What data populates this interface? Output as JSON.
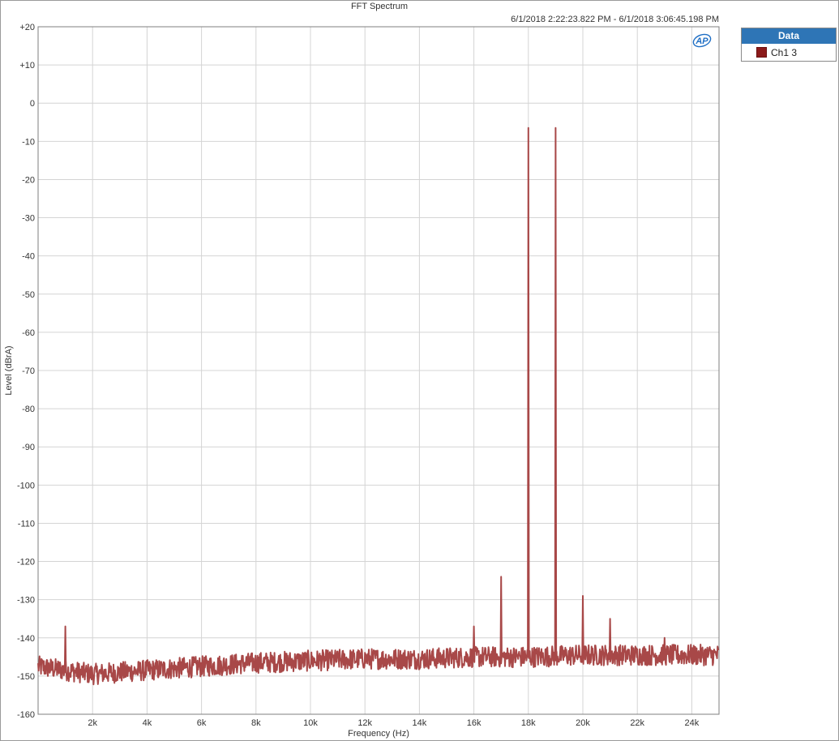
{
  "chart_data": {
    "type": "line",
    "title": "FFT Spectrum",
    "subtitle": "6/1/2018 2:22:23.822 PM - 6/1/2018 3:06:45.198 PM",
    "xlabel": "Frequency (Hz)",
    "ylabel": "Level (dBrA)",
    "xlim": [
      0,
      25000
    ],
    "ylim": [
      -160,
      20
    ],
    "x_ticks": [
      2000,
      4000,
      6000,
      8000,
      10000,
      12000,
      14000,
      16000,
      18000,
      20000,
      22000,
      24000
    ],
    "x_tick_labels": [
      "2k",
      "4k",
      "6k",
      "8k",
      "10k",
      "12k",
      "14k",
      "16k",
      "18k",
      "20k",
      "22k",
      "24k"
    ],
    "y_ticks": [
      20,
      10,
      0,
      -10,
      -20,
      -30,
      -40,
      -50,
      -60,
      -70,
      -80,
      -90,
      -100,
      -110,
      -120,
      -130,
      -140,
      -150,
      -160
    ],
    "y_tick_labels": [
      "+20",
      "+10",
      "0",
      "-10",
      "-20",
      "-30",
      "-40",
      "-50",
      "-60",
      "-70",
      "-80",
      "-90",
      "-100",
      "-110",
      "-120",
      "-130",
      "-140",
      "-150",
      "-160"
    ],
    "grid": true,
    "legend_position": "outside-top-right",
    "legend_title": "Data",
    "series": [
      {
        "name": "Ch1 3",
        "color": "#a84848",
        "noise_floor": [
          [
            0,
            -147.5
          ],
          [
            2000,
            -149.5
          ],
          [
            4000,
            -148.5
          ],
          [
            6000,
            -147.5
          ],
          [
            8000,
            -146.5
          ],
          [
            10000,
            -146
          ],
          [
            12000,
            -145.5
          ],
          [
            14000,
            -145.5
          ],
          [
            16000,
            -145
          ],
          [
            18000,
            -145
          ],
          [
            20000,
            -144.5
          ],
          [
            22000,
            -144.5
          ],
          [
            24000,
            -144.5
          ],
          [
            25000,
            -144.5
          ]
        ],
        "peaks": [
          {
            "x": 1000,
            "y": -137
          },
          {
            "x": 16000,
            "y": -137
          },
          {
            "x": 17000,
            "y": -124
          },
          {
            "x": 18000,
            "y": -6.5
          },
          {
            "x": 19000,
            "y": -6.5
          },
          {
            "x": 20000,
            "y": -129
          },
          {
            "x": 21000,
            "y": -135
          },
          {
            "x": 23000,
            "y": -140
          }
        ]
      }
    ]
  },
  "legend": {
    "header": "Data",
    "entry": "Ch1 3"
  },
  "logo": {
    "text": "AP",
    "color": "#1f6fc5"
  }
}
